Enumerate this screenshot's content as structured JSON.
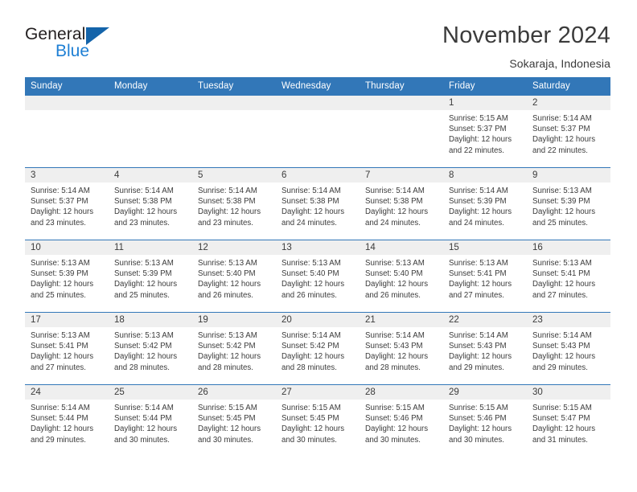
{
  "brand": {
    "name_part1": "General",
    "name_part2": "Blue",
    "triangle_color": "#1464aa",
    "blue_text_color": "#1e7fd4"
  },
  "header": {
    "month_title": "November 2024",
    "location": "Sokaraja, Indonesia",
    "header_bg_color": "#3277b8",
    "daynum_bg_color": "#efefef"
  },
  "weekday_headers": [
    "Sunday",
    "Monday",
    "Tuesday",
    "Wednesday",
    "Thursday",
    "Friday",
    "Saturday"
  ],
  "weeks": [
    [
      {
        "day": "",
        "sunrise": "",
        "sunset": "",
        "daylight_line1": "",
        "daylight_line2": "",
        "empty": true
      },
      {
        "day": "",
        "sunrise": "",
        "sunset": "",
        "daylight_line1": "",
        "daylight_line2": "",
        "empty": true
      },
      {
        "day": "",
        "sunrise": "",
        "sunset": "",
        "daylight_line1": "",
        "daylight_line2": "",
        "empty": true
      },
      {
        "day": "",
        "sunrise": "",
        "sunset": "",
        "daylight_line1": "",
        "daylight_line2": "",
        "empty": true
      },
      {
        "day": "",
        "sunrise": "",
        "sunset": "",
        "daylight_line1": "",
        "daylight_line2": "",
        "empty": true
      },
      {
        "day": "1",
        "sunrise": "Sunrise: 5:15 AM",
        "sunset": "Sunset: 5:37 PM",
        "daylight_line1": "Daylight: 12 hours",
        "daylight_line2": "and 22 minutes."
      },
      {
        "day": "2",
        "sunrise": "Sunrise: 5:14 AM",
        "sunset": "Sunset: 5:37 PM",
        "daylight_line1": "Daylight: 12 hours",
        "daylight_line2": "and 22 minutes."
      }
    ],
    [
      {
        "day": "3",
        "sunrise": "Sunrise: 5:14 AM",
        "sunset": "Sunset: 5:37 PM",
        "daylight_line1": "Daylight: 12 hours",
        "daylight_line2": "and 23 minutes."
      },
      {
        "day": "4",
        "sunrise": "Sunrise: 5:14 AM",
        "sunset": "Sunset: 5:38 PM",
        "daylight_line1": "Daylight: 12 hours",
        "daylight_line2": "and 23 minutes."
      },
      {
        "day": "5",
        "sunrise": "Sunrise: 5:14 AM",
        "sunset": "Sunset: 5:38 PM",
        "daylight_line1": "Daylight: 12 hours",
        "daylight_line2": "and 23 minutes."
      },
      {
        "day": "6",
        "sunrise": "Sunrise: 5:14 AM",
        "sunset": "Sunset: 5:38 PM",
        "daylight_line1": "Daylight: 12 hours",
        "daylight_line2": "and 24 minutes."
      },
      {
        "day": "7",
        "sunrise": "Sunrise: 5:14 AM",
        "sunset": "Sunset: 5:38 PM",
        "daylight_line1": "Daylight: 12 hours",
        "daylight_line2": "and 24 minutes."
      },
      {
        "day": "8",
        "sunrise": "Sunrise: 5:14 AM",
        "sunset": "Sunset: 5:39 PM",
        "daylight_line1": "Daylight: 12 hours",
        "daylight_line2": "and 24 minutes."
      },
      {
        "day": "9",
        "sunrise": "Sunrise: 5:13 AM",
        "sunset": "Sunset: 5:39 PM",
        "daylight_line1": "Daylight: 12 hours",
        "daylight_line2": "and 25 minutes."
      }
    ],
    [
      {
        "day": "10",
        "sunrise": "Sunrise: 5:13 AM",
        "sunset": "Sunset: 5:39 PM",
        "daylight_line1": "Daylight: 12 hours",
        "daylight_line2": "and 25 minutes."
      },
      {
        "day": "11",
        "sunrise": "Sunrise: 5:13 AM",
        "sunset": "Sunset: 5:39 PM",
        "daylight_line1": "Daylight: 12 hours",
        "daylight_line2": "and 25 minutes."
      },
      {
        "day": "12",
        "sunrise": "Sunrise: 5:13 AM",
        "sunset": "Sunset: 5:40 PM",
        "daylight_line1": "Daylight: 12 hours",
        "daylight_line2": "and 26 minutes."
      },
      {
        "day": "13",
        "sunrise": "Sunrise: 5:13 AM",
        "sunset": "Sunset: 5:40 PM",
        "daylight_line1": "Daylight: 12 hours",
        "daylight_line2": "and 26 minutes."
      },
      {
        "day": "14",
        "sunrise": "Sunrise: 5:13 AM",
        "sunset": "Sunset: 5:40 PM",
        "daylight_line1": "Daylight: 12 hours",
        "daylight_line2": "and 26 minutes."
      },
      {
        "day": "15",
        "sunrise": "Sunrise: 5:13 AM",
        "sunset": "Sunset: 5:41 PM",
        "daylight_line1": "Daylight: 12 hours",
        "daylight_line2": "and 27 minutes."
      },
      {
        "day": "16",
        "sunrise": "Sunrise: 5:13 AM",
        "sunset": "Sunset: 5:41 PM",
        "daylight_line1": "Daylight: 12 hours",
        "daylight_line2": "and 27 minutes."
      }
    ],
    [
      {
        "day": "17",
        "sunrise": "Sunrise: 5:13 AM",
        "sunset": "Sunset: 5:41 PM",
        "daylight_line1": "Daylight: 12 hours",
        "daylight_line2": "and 27 minutes."
      },
      {
        "day": "18",
        "sunrise": "Sunrise: 5:13 AM",
        "sunset": "Sunset: 5:42 PM",
        "daylight_line1": "Daylight: 12 hours",
        "daylight_line2": "and 28 minutes."
      },
      {
        "day": "19",
        "sunrise": "Sunrise: 5:13 AM",
        "sunset": "Sunset: 5:42 PM",
        "daylight_line1": "Daylight: 12 hours",
        "daylight_line2": "and 28 minutes."
      },
      {
        "day": "20",
        "sunrise": "Sunrise: 5:14 AM",
        "sunset": "Sunset: 5:42 PM",
        "daylight_line1": "Daylight: 12 hours",
        "daylight_line2": "and 28 minutes."
      },
      {
        "day": "21",
        "sunrise": "Sunrise: 5:14 AM",
        "sunset": "Sunset: 5:43 PM",
        "daylight_line1": "Daylight: 12 hours",
        "daylight_line2": "and 28 minutes."
      },
      {
        "day": "22",
        "sunrise": "Sunrise: 5:14 AM",
        "sunset": "Sunset: 5:43 PM",
        "daylight_line1": "Daylight: 12 hours",
        "daylight_line2": "and 29 minutes."
      },
      {
        "day": "23",
        "sunrise": "Sunrise: 5:14 AM",
        "sunset": "Sunset: 5:43 PM",
        "daylight_line1": "Daylight: 12 hours",
        "daylight_line2": "and 29 minutes."
      }
    ],
    [
      {
        "day": "24",
        "sunrise": "Sunrise: 5:14 AM",
        "sunset": "Sunset: 5:44 PM",
        "daylight_line1": "Daylight: 12 hours",
        "daylight_line2": "and 29 minutes."
      },
      {
        "day": "25",
        "sunrise": "Sunrise: 5:14 AM",
        "sunset": "Sunset: 5:44 PM",
        "daylight_line1": "Daylight: 12 hours",
        "daylight_line2": "and 30 minutes."
      },
      {
        "day": "26",
        "sunrise": "Sunrise: 5:15 AM",
        "sunset": "Sunset: 5:45 PM",
        "daylight_line1": "Daylight: 12 hours",
        "daylight_line2": "and 30 minutes."
      },
      {
        "day": "27",
        "sunrise": "Sunrise: 5:15 AM",
        "sunset": "Sunset: 5:45 PM",
        "daylight_line1": "Daylight: 12 hours",
        "daylight_line2": "and 30 minutes."
      },
      {
        "day": "28",
        "sunrise": "Sunrise: 5:15 AM",
        "sunset": "Sunset: 5:46 PM",
        "daylight_line1": "Daylight: 12 hours",
        "daylight_line2": "and 30 minutes."
      },
      {
        "day": "29",
        "sunrise": "Sunrise: 5:15 AM",
        "sunset": "Sunset: 5:46 PM",
        "daylight_line1": "Daylight: 12 hours",
        "daylight_line2": "and 30 minutes."
      },
      {
        "day": "30",
        "sunrise": "Sunrise: 5:15 AM",
        "sunset": "Sunset: 5:47 PM",
        "daylight_line1": "Daylight: 12 hours",
        "daylight_line2": "and 31 minutes."
      }
    ]
  ]
}
